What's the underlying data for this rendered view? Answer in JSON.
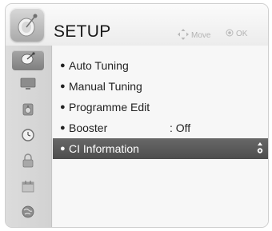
{
  "header": {
    "title": "SETUP",
    "move_label": "Move",
    "ok_label": "OK"
  },
  "sidebar": {
    "items": [
      {
        "icon": "satellite-dish-icon",
        "active": true
      },
      {
        "icon": "tv-screen-icon",
        "active": false
      },
      {
        "icon": "speaker-icon",
        "active": false
      },
      {
        "icon": "clock-icon",
        "active": false
      },
      {
        "icon": "lock-icon",
        "active": false
      },
      {
        "icon": "calendar-icon",
        "active": false
      },
      {
        "icon": "globe-icon",
        "active": false
      }
    ]
  },
  "menu": {
    "items": [
      {
        "label": "Auto Tuning"
      },
      {
        "label": "Manual Tuning"
      },
      {
        "label": "Programme Edit"
      },
      {
        "label": "Booster",
        "value": ": Off"
      },
      {
        "label": "CI Information",
        "selected": true
      }
    ]
  },
  "colors": {
    "highlight": "#5a5a5a",
    "sidebar_active": "#8c8c8c"
  }
}
